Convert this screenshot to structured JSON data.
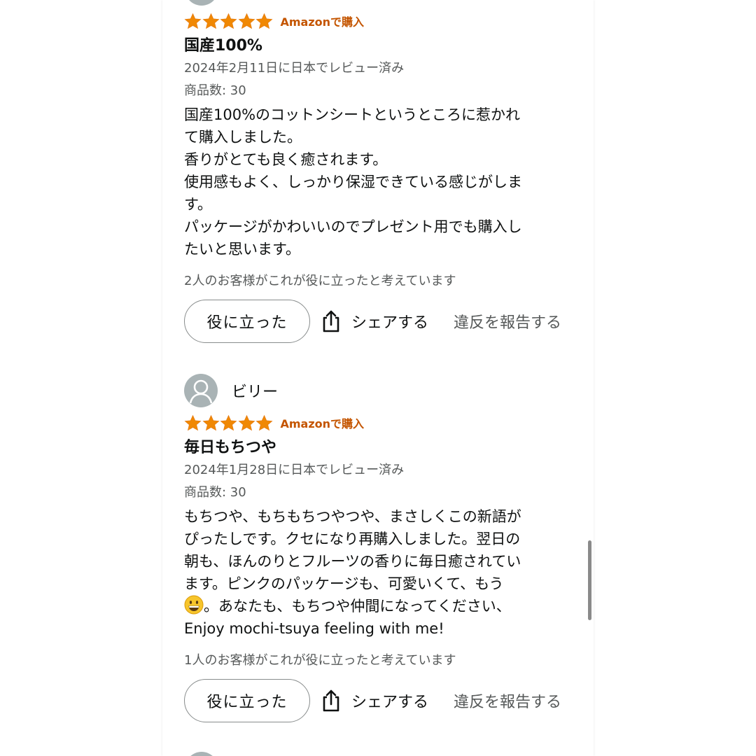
{
  "colors": {
    "star": "#f08804",
    "verified": "#c45500",
    "meta": "#565959",
    "text": "#0f1111",
    "avatar": "#a9b3b5"
  },
  "reviews": [
    {
      "reviewer": "",
      "rating": 5,
      "verified": "Amazonで購入",
      "title": "国産100%",
      "date": "2024年2月11日に日本でレビュー済み",
      "quantity": "商品数: 30",
      "body_lines": [
        "国産100%のコットンシートというところに惹かれ",
        "て購入しました。",
        "香りがとても良く癒されます。",
        "使用感もよく、しっかり保湿できている感じがしま",
        "す。",
        "パッケージがかわいいのでプレゼント用でも購入し",
        "たいと思います。"
      ],
      "helpful_count": "2人のお客様がこれが役に立ったと考えています",
      "helpful_label": "役に立った",
      "share_label": "シェアする",
      "report_label": "違反を報告する"
    },
    {
      "reviewer": "ビリー",
      "rating": 5,
      "verified": "Amazonで購入",
      "title": "毎日もちつや",
      "date": "2024年1月28日に日本でレビュー済み",
      "quantity": "商品数: 30",
      "body_lines": [
        "もちつや、もちもちつやつや、まさしくこの新語が",
        "ぴったしです。クセになり再購入しました。翌日の",
        "朝も、ほんのりとフルーツの香りに毎日癒されてい",
        "ます。ピンクのパッケージも、可愛いくて、もう",
        "。あなたも、もちつや仲間になってください、",
        "Enjoy mochi-tsuya feeling with me!"
      ],
      "emoji_icon": "grinning-face-emoji",
      "helpful_count": "1人のお客様がこれが役に立ったと考えています",
      "helpful_label": "役に立った",
      "share_label": "シェアする",
      "report_label": "違反を報告する"
    }
  ]
}
